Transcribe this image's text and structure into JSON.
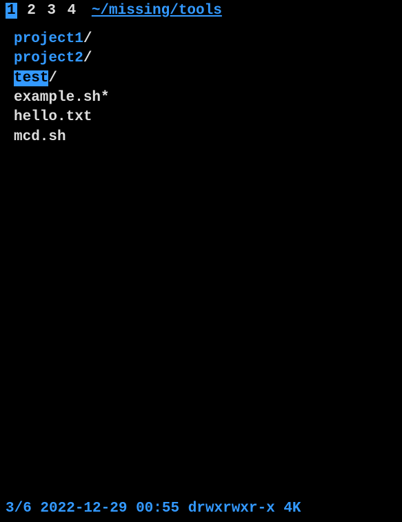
{
  "header": {
    "tabs": [
      "1",
      "2",
      "3",
      "4"
    ],
    "active_tab_index": 0,
    "path": "~/missing/tools"
  },
  "entries": [
    {
      "name": "project1",
      "suffix": "/",
      "type": "dir",
      "selected": false
    },
    {
      "name": "project2",
      "suffix": "/",
      "type": "dir",
      "selected": false
    },
    {
      "name": "test",
      "suffix": "/",
      "type": "dir",
      "selected": true
    },
    {
      "name": "example.sh",
      "suffix": "*",
      "type": "exec",
      "selected": false
    },
    {
      "name": "hello.txt",
      "suffix": "",
      "type": "file",
      "selected": false
    },
    {
      "name": "mcd.sh",
      "suffix": "",
      "type": "file",
      "selected": false
    }
  ],
  "statusbar": {
    "position": "3/6",
    "date": "2022-12-29",
    "time": "00:55",
    "permissions": "drwxrwxr-x",
    "size": "4K"
  }
}
